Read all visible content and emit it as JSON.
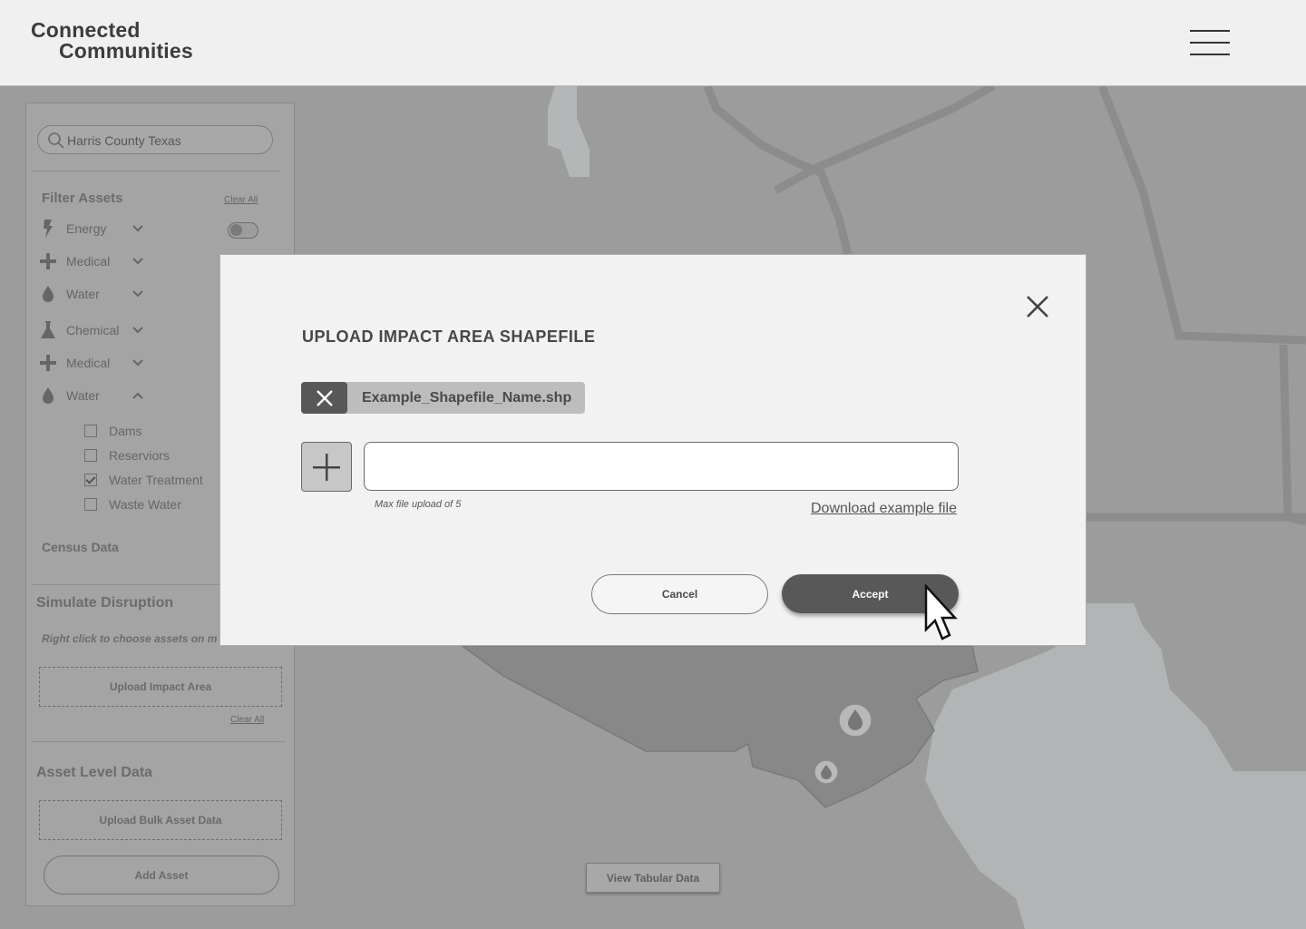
{
  "header": {
    "logo_line1": "Connected",
    "logo_line2": "Communities"
  },
  "sidebar": {
    "search_value": "Harris County Texas",
    "filter_title": "Filter Assets",
    "filter_clear": "Clear All",
    "categories": [
      {
        "label": "Energy",
        "icon": "lightning-icon"
      },
      {
        "label": "Medical",
        "icon": "plus-icon"
      },
      {
        "label": "Water",
        "icon": "drop-icon"
      },
      {
        "label": "Chemical",
        "icon": "flask-icon"
      },
      {
        "label": "Medical",
        "icon": "plus-icon"
      },
      {
        "label": "Water",
        "icon": "drop-icon",
        "expanded": true
      }
    ],
    "water_sub": [
      {
        "label": "Dams",
        "checked": false
      },
      {
        "label": "Reserviors",
        "checked": false
      },
      {
        "label": "Water Treatment",
        "checked": true
      },
      {
        "label": "Waste Water",
        "checked": false
      }
    ],
    "census_title": "Census Data",
    "simulate_title": "Simulate Disruption",
    "simulate_hint": "Right click to choose assets on m",
    "upload_impact": "Upload Impact Area",
    "simulate_clear": "Clear All",
    "asset_title": "Asset Level Data",
    "upload_bulk": "Upload Bulk Asset Data",
    "add_asset": "Add Asset"
  },
  "map": {
    "view_tabular": "View Tabular Data"
  },
  "modal": {
    "title": "UPLOAD IMPACT AREA SHAPEFILE",
    "file_name": "Example_Shapefile_Name.shp",
    "file_input_value": "",
    "hint": "Max file upload of 5",
    "download_link": "Download example file",
    "cancel": "Cancel",
    "accept": "Accept"
  },
  "colors": {
    "header_bg": "#f0f0f0",
    "map_bg": "#9a9a9a",
    "modal_bg": "#f2f2f2",
    "accent_dark": "#585858"
  }
}
